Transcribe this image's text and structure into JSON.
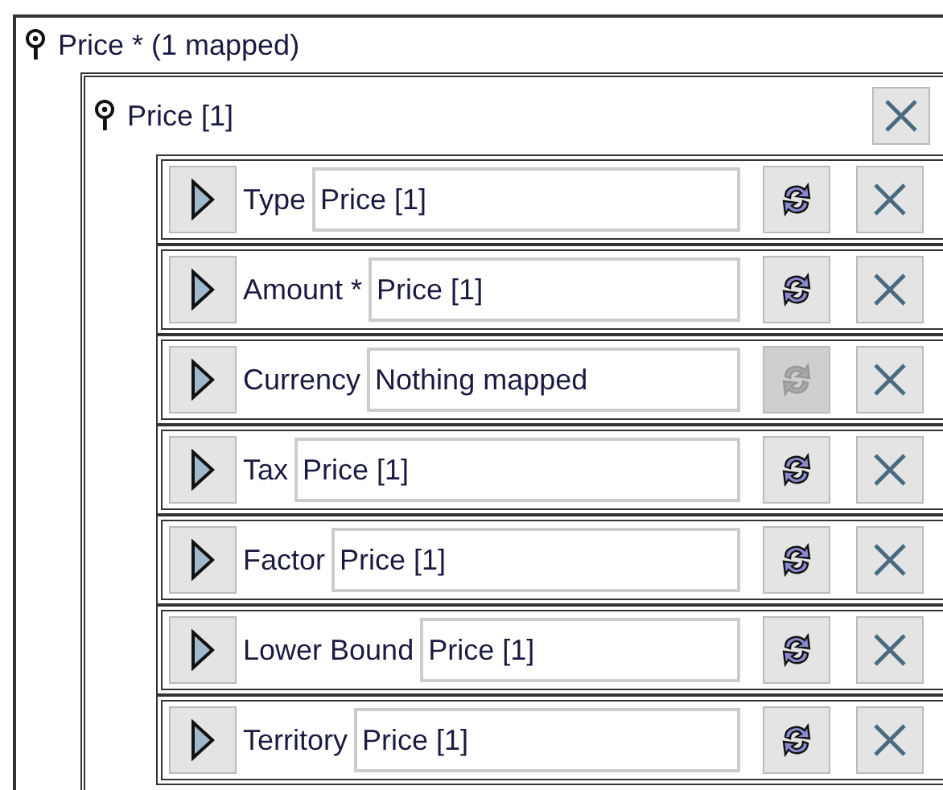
{
  "group": {
    "title": "Price * (1 mapped)",
    "entry": {
      "title": "Price [1]",
      "fields": [
        {
          "label": "Type",
          "value": "Price [1]",
          "refresh_disabled": false
        },
        {
          "label": "Amount *",
          "value": "Price [1]",
          "refresh_disabled": false
        },
        {
          "label": "Currency",
          "value": "Nothing mapped",
          "refresh_disabled": true
        },
        {
          "label": "Tax",
          "value": "Price [1]",
          "refresh_disabled": false
        },
        {
          "label": "Factor",
          "value": "Price [1]",
          "refresh_disabled": false
        },
        {
          "label": "Lower Bound",
          "value": "Price [1]",
          "refresh_disabled": false
        },
        {
          "label": "Territory",
          "value": "Price [1]",
          "refresh_disabled": false
        }
      ]
    }
  }
}
